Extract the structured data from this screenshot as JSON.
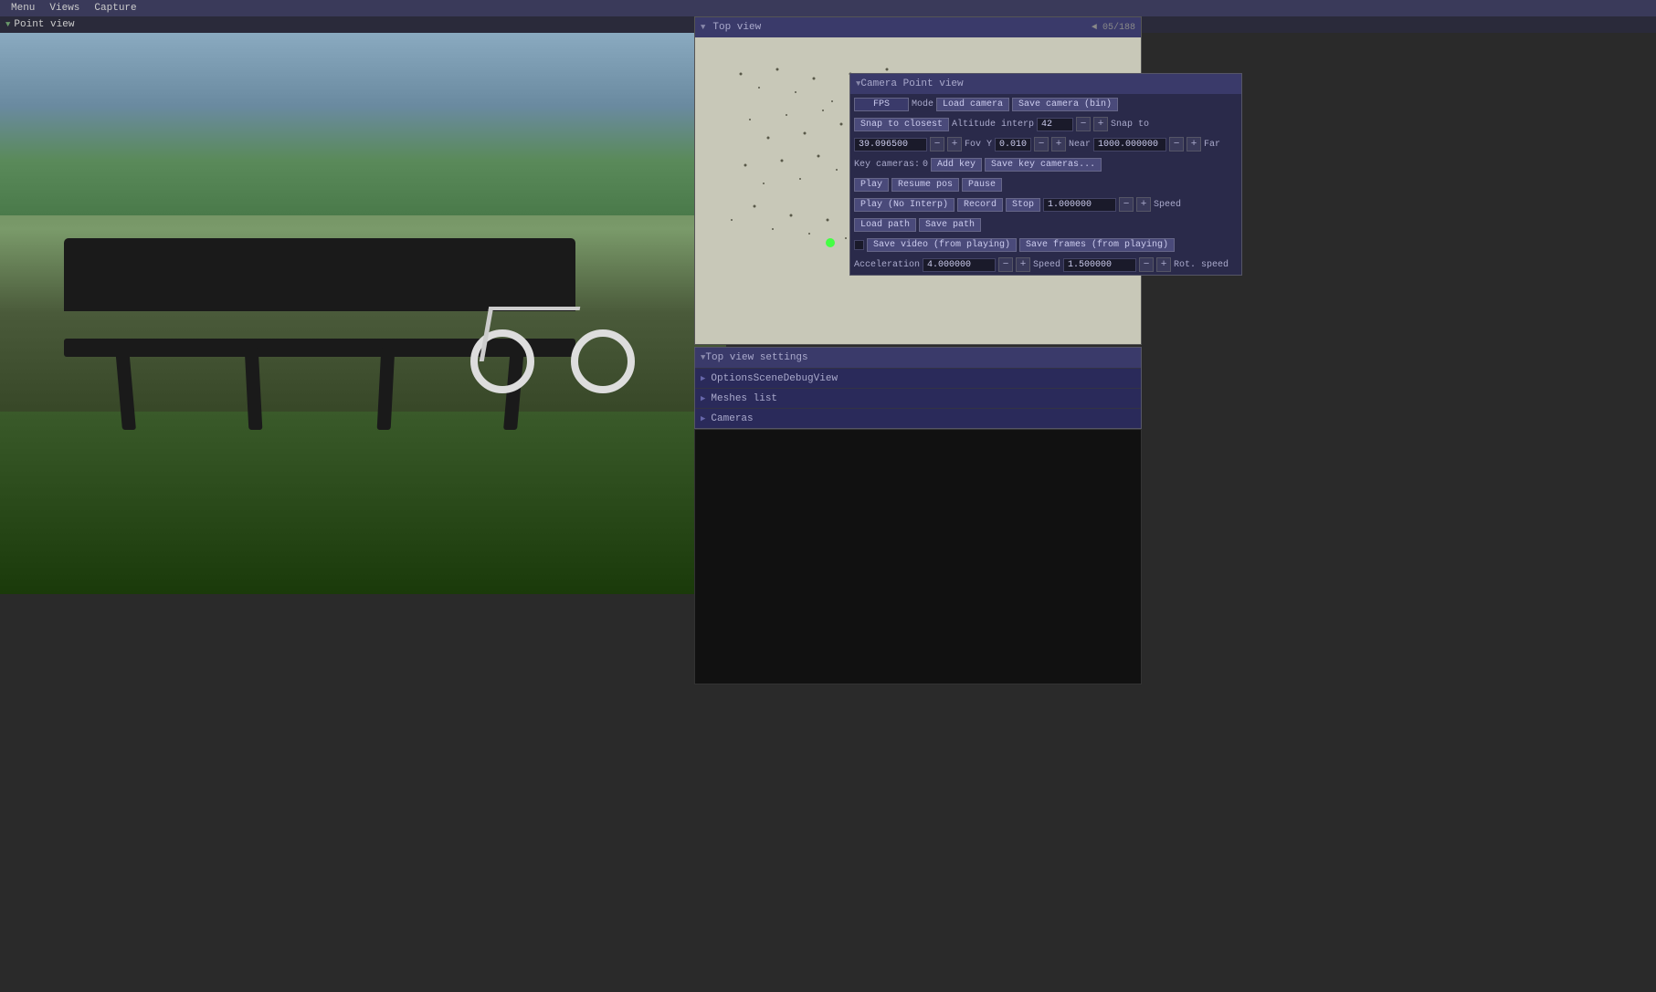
{
  "menubar": {
    "items": [
      "Menu",
      "Views",
      "Capture"
    ]
  },
  "titlebar": {
    "label": "Point view"
  },
  "top_view_panel": {
    "title": "Top view",
    "faint_text": "◄ 05/188"
  },
  "camera_panel": {
    "title": "Camera Point view",
    "fps_label": "FPS",
    "mode_label": "Mode",
    "load_camera_btn": "Load camera",
    "save_camera_btn": "Save camera (bin)",
    "snap_closest_btn": "Snap to closest",
    "altitude_label": "Altitude interp",
    "altitude_value": "42",
    "snap_to_label": "Snap to",
    "fov_value": "39.096500",
    "fov_minus": "−",
    "fov_plus": "+",
    "fov_y_label": "Fov Y",
    "fov_y_value": "0.010000",
    "fov_y_minus": "−",
    "fov_y_plus": "+",
    "near_label": "Near",
    "near_value": "1000.000000",
    "near_minus": "−",
    "near_plus": "+",
    "far_label": "Far",
    "key_cameras_label": "Key cameras:",
    "key_cameras_value": "0",
    "add_key_btn": "Add key",
    "save_key_cameras_btn": "Save key cameras...",
    "play_btn": "Play",
    "resume_pos_btn": "Resume pos",
    "pause_btn": "Pause",
    "play_no_interp_btn": "Play (No Interp)",
    "record_btn": "Record",
    "stop_btn": "Stop",
    "speed_value": "1.000000",
    "speed_minus": "−",
    "speed_plus": "+",
    "speed_label": "Speed",
    "load_path_btn": "Load path",
    "save_path_btn": "Save path",
    "save_video_btn": "Save video (from playing)",
    "save_frames_btn": "Save frames (from playing)",
    "acceleration_label": "Acceleration",
    "acceleration_value": "4.000000",
    "acc_minus": "−",
    "acc_plus": "+",
    "speed2_label": "Speed",
    "speed2_value": "1.500000",
    "speed2_minus": "−",
    "speed2_plus": "+",
    "rot_speed_label": "Rot. speed"
  },
  "settings_panel": {
    "title": "Top view settings",
    "items": [
      {
        "label": "OptionsSceneDebugView",
        "expanded": false
      },
      {
        "label": "Meshes list",
        "expanded": false
      },
      {
        "label": "Cameras",
        "expanded": false
      }
    ]
  }
}
